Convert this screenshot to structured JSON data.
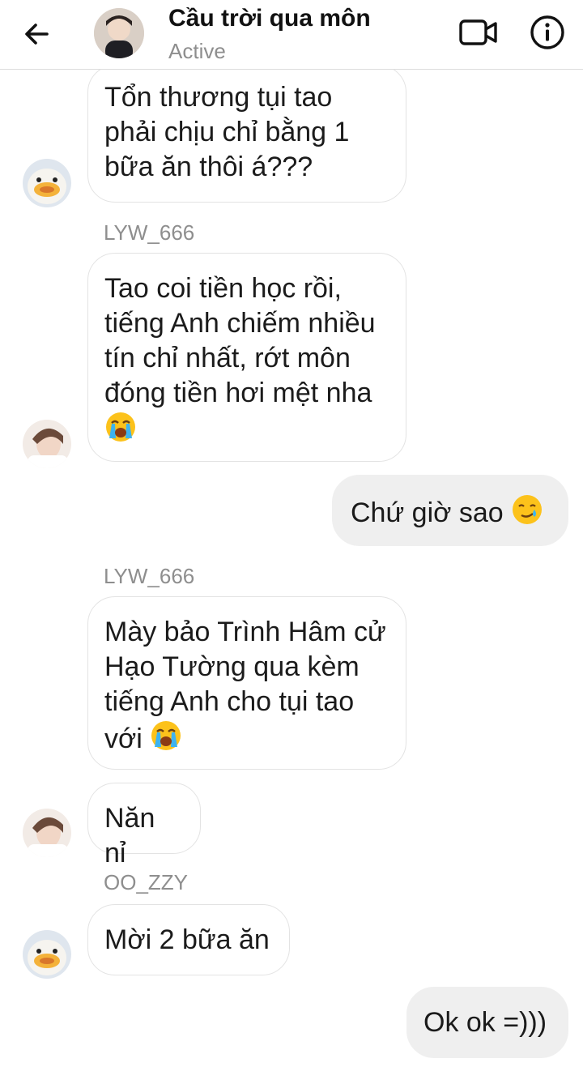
{
  "header": {
    "title": "Cầu trời qua môn",
    "status": "Active"
  },
  "messages": [
    {
      "id": "m1",
      "direction": "in",
      "text": "Tổn thương tụi tao phải chịu chỉ bằng 1 bữa ăn thôi á???",
      "avatar": "duck-avatar"
    },
    {
      "id": "m2",
      "direction": "in",
      "sender": "LYW_666",
      "text": "Tao coi tiền học rồi, tiếng Anh chiếm nhiều tín chỉ nhất, rớt môn đóng tiền hơi mệt nha",
      "emoji": "loudly-crying-face-emoji",
      "avatar": "person-avatar"
    },
    {
      "id": "m3",
      "direction": "out",
      "text": "Chứ giờ sao",
      "emoji": "smiling-face-with-tear-emoji"
    },
    {
      "id": "m4",
      "direction": "in",
      "sender": "LYW_666",
      "text": "Mày bảo Trình Hâm cử Hạo Tường qua kèm tiếng Anh cho tụi tao với",
      "emoji": "loudly-crying-face-emoji"
    },
    {
      "id": "m5",
      "direction": "in",
      "text": "Năn nỉ",
      "avatar": "person-avatar"
    },
    {
      "id": "m6",
      "direction": "in",
      "sender": "OO_ZZY",
      "text": "Mời 2 bữa ăn",
      "avatar": "duck-avatar"
    },
    {
      "id": "m7",
      "direction": "out",
      "text": "Ok ok =)))"
    }
  ],
  "colors": {
    "incoming_bubble": "#ffffff",
    "outgoing_bubble": "#efefef",
    "muted_text": "#8e8e8e",
    "divider": "#dcdcdc"
  }
}
